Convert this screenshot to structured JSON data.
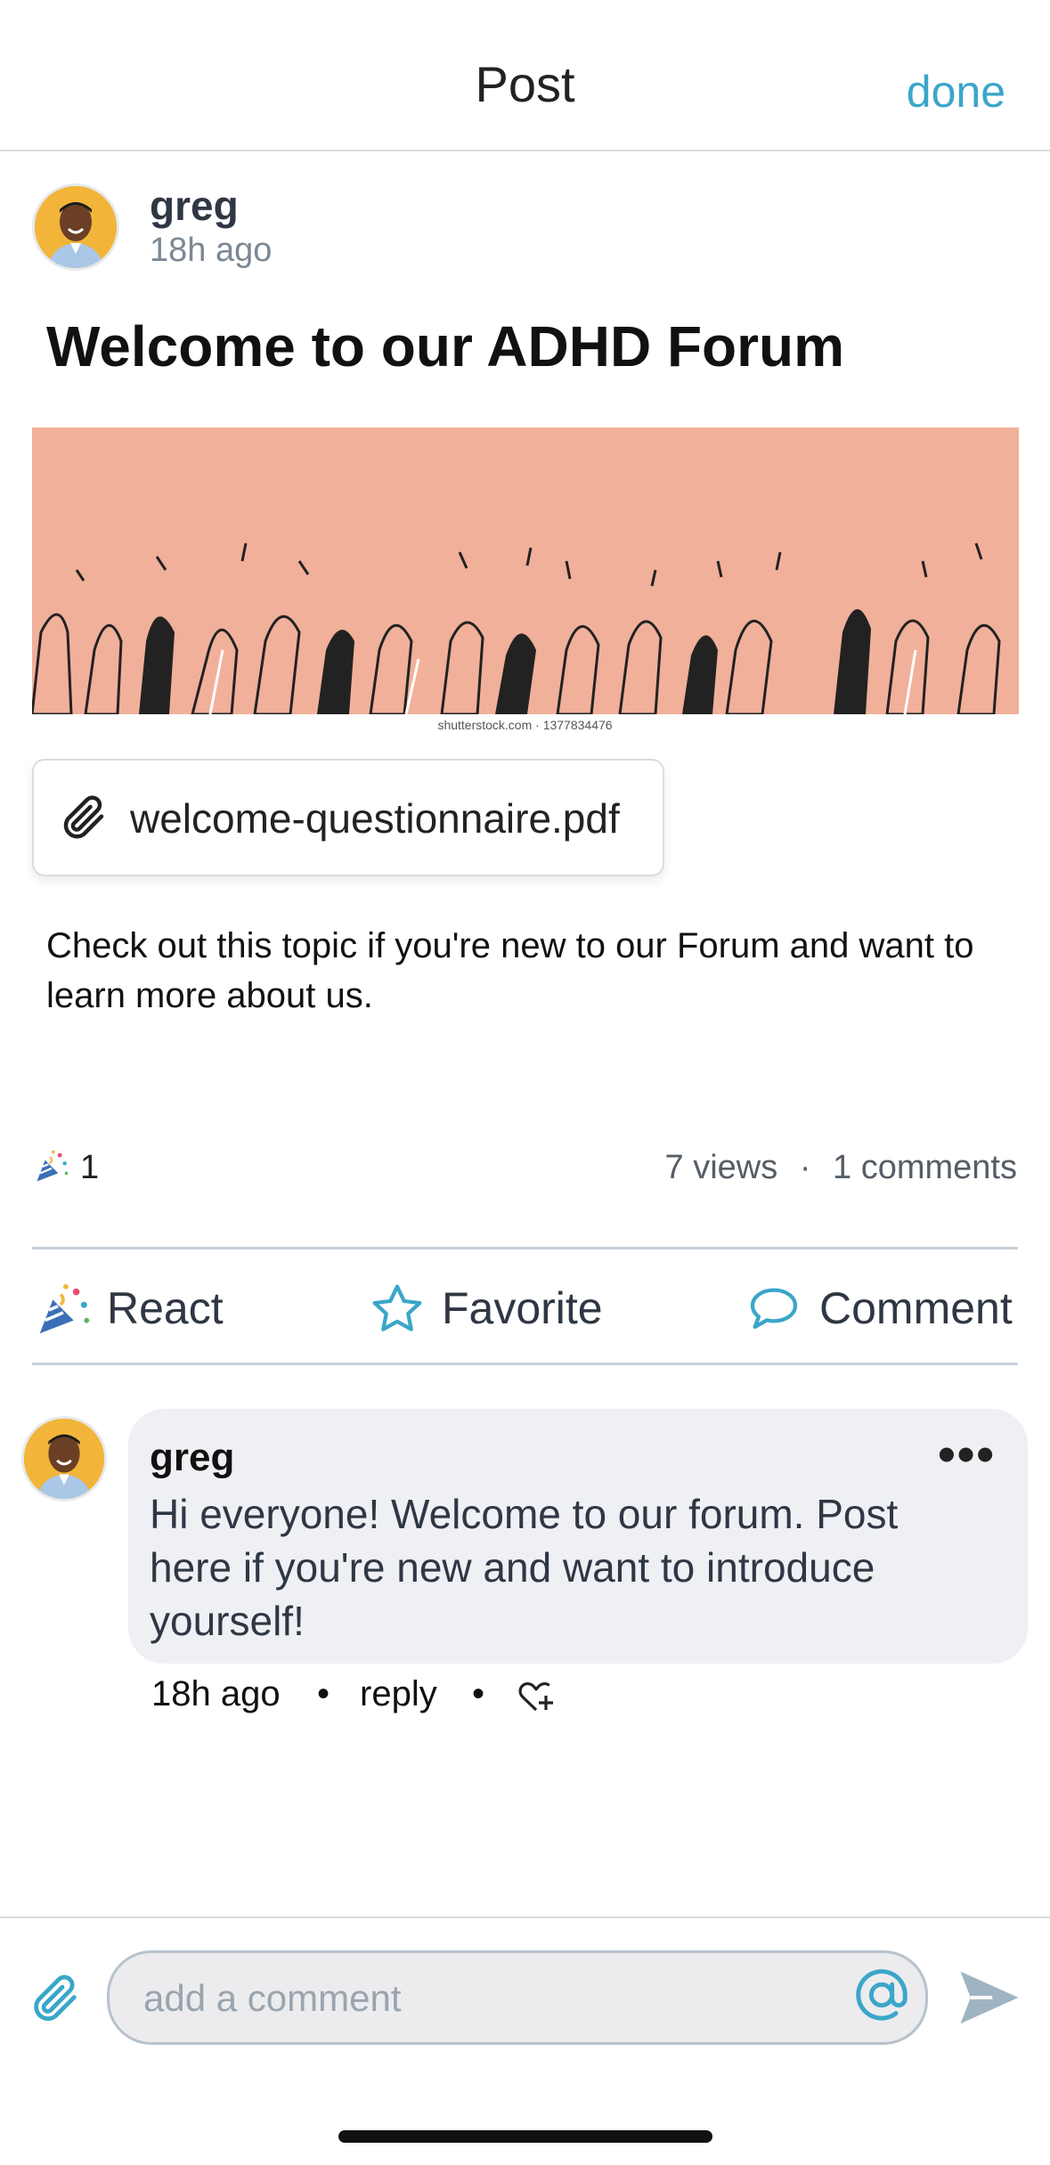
{
  "header": {
    "title": "Post",
    "done_label": "done"
  },
  "post": {
    "author": "greg",
    "time": "18h ago",
    "title": "Welcome to our ADHD Forum",
    "image_credit": "shutterstock.com · 1377834476",
    "attachment": {
      "icon": "paperclip-icon",
      "name": "welcome-questionnaire.pdf"
    },
    "body": "Check out this topic if you're new to our Forum and want to learn more about us.",
    "reaction_count": "1",
    "views": "7 views",
    "comments": "1 comments"
  },
  "actions": {
    "react_label": "React",
    "favorite_label": "Favorite",
    "comment_label": "Comment"
  },
  "comment": {
    "author": "greg",
    "text": "Hi everyone! Welcome to our forum. Post here if you're new and want to introduce yourself!",
    "time": "18h ago",
    "reply_label": "reply"
  },
  "composer": {
    "placeholder": "add a comment"
  },
  "colors": {
    "accent": "#3aa6c9",
    "banner": "#f1b09a",
    "divider": "#c8d2dc",
    "bubble": "#eff0f4"
  }
}
